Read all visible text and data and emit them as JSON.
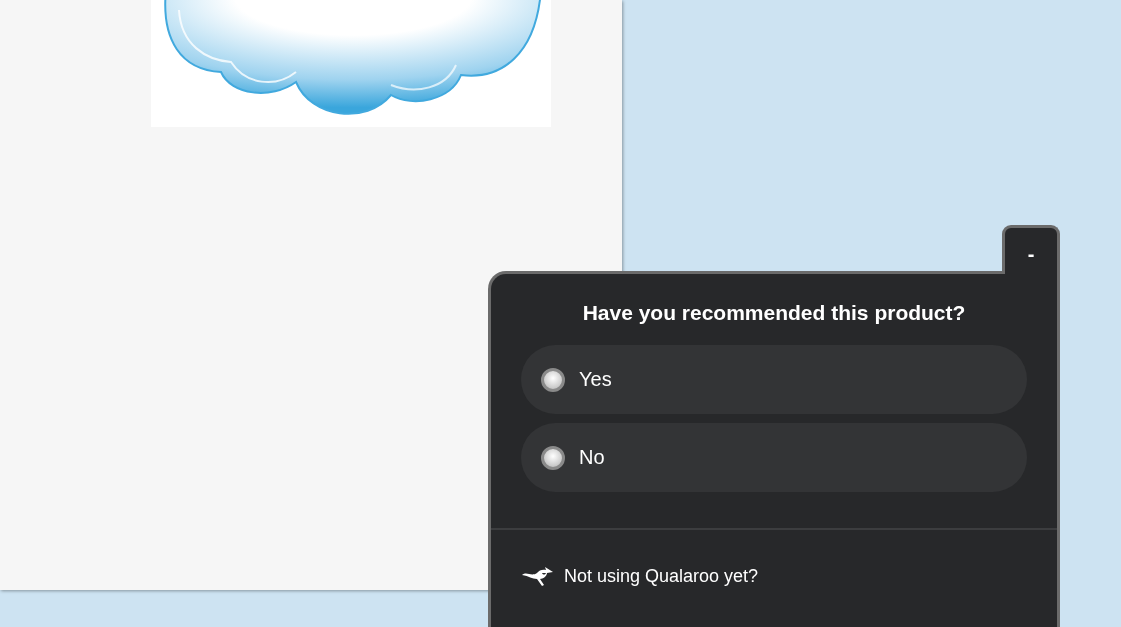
{
  "survey": {
    "minimize": "-",
    "question": "Have you recommended this product?",
    "options": [
      {
        "label": "Yes",
        "selected": false
      },
      {
        "label": "No",
        "selected": false
      }
    ],
    "footer": "Not using Qualaroo yet?"
  }
}
